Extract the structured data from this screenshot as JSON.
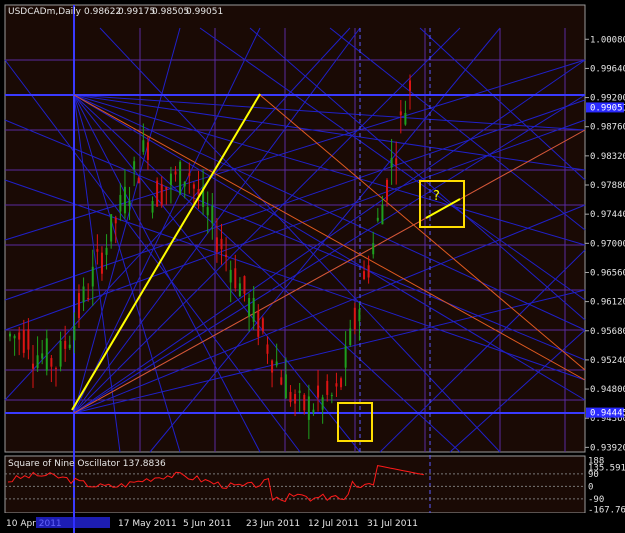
{
  "chart_data": [
    {
      "type": "candlestick",
      "header": {
        "symbol": "USDCADm,Daily",
        "open": "0.98622",
        "high": "0.99175",
        "low": "0.98505",
        "close": "0.99051"
      },
      "ylim": [
        0.9385,
        1.0025
      ],
      "y_ticks": [
        "1.00080",
        "0.99640",
        "0.99200",
        "0.98760",
        "0.98320",
        "0.97880",
        "0.97440",
        "0.97000",
        "0.96560",
        "0.96120",
        "0.95680",
        "0.95240",
        "0.94800",
        "0.94360",
        "0.93920"
      ],
      "price_markers": [
        {
          "label": "0.99051",
          "value": 0.99051
        },
        {
          "label": "0.94445",
          "value": 0.94445
        }
      ],
      "x_ticks": [
        "10 Apr 2011",
        "17 May 2011",
        "5 Jun 2011",
        "23 Jun 2011",
        "12 Jul 2011",
        "31 Jul 2011"
      ],
      "annotations": [
        "?"
      ],
      "colors": {
        "background": "#1a0a05",
        "grid_fan": "#2020c8",
        "gann_lines": "#e05a20",
        "trend_line": "#ffff00",
        "bull_candle": "#1ea01e",
        "bear_candle": "#dc1414",
        "box": "#ffdd00",
        "oscillator": "#ff1a1a",
        "axis_text": "#e6e6e6"
      },
      "candles": {
        "count": 88,
        "series": [
          {
            "name": "bull"
          },
          {
            "name": "bear"
          }
        ]
      }
    },
    {
      "type": "line",
      "title": "Square of Nine Oscillator 137.8836",
      "y_ticks": [
        "188",
        "135.5915",
        "90",
        "0",
        "-90",
        "-167.762"
      ],
      "ylim": [
        -170,
        190
      ]
    }
  ]
}
